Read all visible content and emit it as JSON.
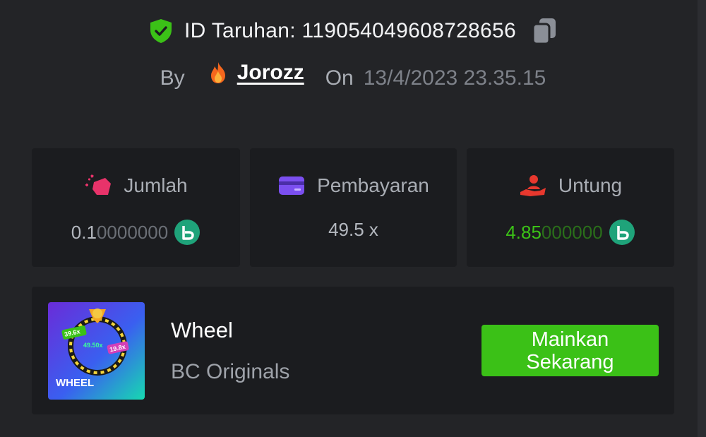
{
  "bet": {
    "id_label": "ID Taruhan: 1190540496087286 56",
    "by_label": "By",
    "username": "Jorozz",
    "on_label": "On",
    "datetime": "13/4/2023 23.35.15"
  },
  "stats": [
    {
      "label": "Jumlah",
      "value_strong": "0.1",
      "value_faded": "0000000",
      "icon": "bet-amount-icon"
    },
    {
      "label": "Pembayaran",
      "value": "49.5 x",
      "icon": "payout-card-icon"
    },
    {
      "label": "Untung",
      "value_strong": "4.85",
      "value_faded": "000000",
      "icon": "profit-hand-icon"
    }
  ],
  "game": {
    "name": "Wheel",
    "provider": "BC Originals",
    "play_label": "Mainkan Sekarang",
    "thumb_title": "WHEEL",
    "thumb_multipliers": [
      "39.6x",
      "49.50x",
      "19.8x"
    ]
  },
  "colors": {
    "background": "#232427",
    "card": "#1b1c1f",
    "play_button": "#3bc117",
    "profit_green": "#3bc117",
    "bc_coin": "#1fa37a",
    "verified_green": "#3bc117",
    "amount_icon": "#e8336a",
    "payout_icon": "#7b4ff0",
    "profit_icon": "#e8382e"
  }
}
